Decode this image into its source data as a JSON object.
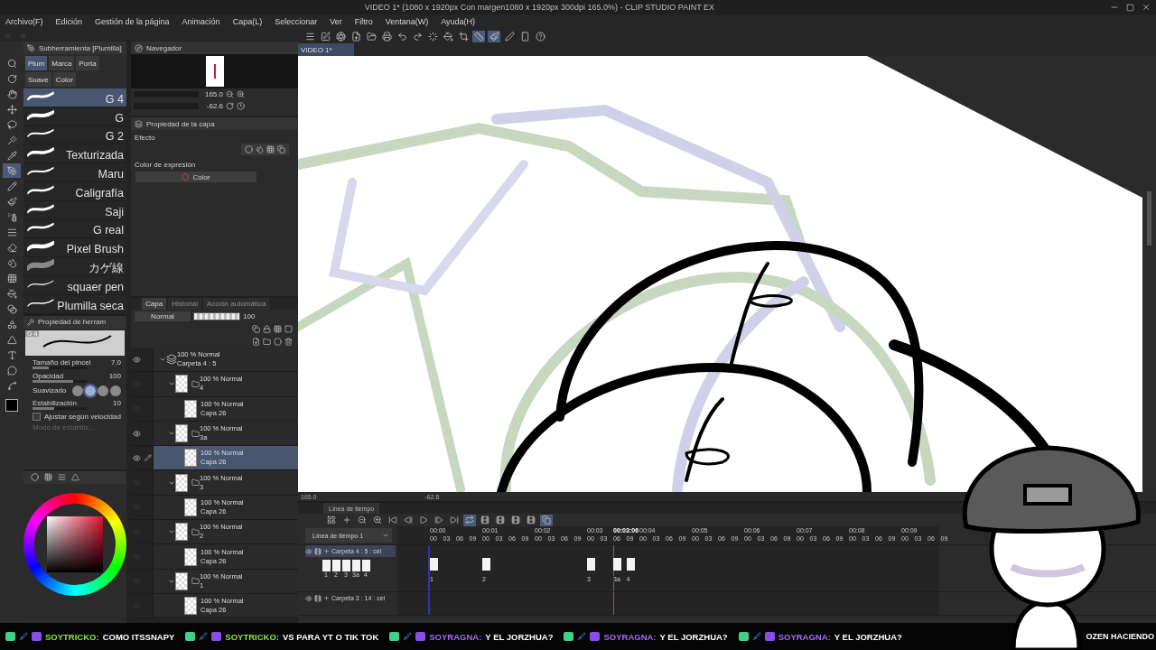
{
  "window": {
    "title": "VIDEO 1* (1080 x 1920px Con margen1080 x 1920px 300dpi 165.0%) - CLIP STUDIO PAINT EX"
  },
  "menu": [
    "Archivo(F)",
    "Edición",
    "Gestión de la página",
    "Animación",
    "Capa(L)",
    "Seleccionar",
    "Ver",
    "Filtro",
    "Ventana(W)",
    "Ayuda(H)"
  ],
  "toolbar": [
    {
      "kind": "menu",
      "selected": false
    },
    {
      "kind": "edit",
      "selected": false
    },
    {
      "kind": "logo",
      "selected": false
    },
    {
      "kind": "new",
      "selected": false
    },
    {
      "kind": "open",
      "selected": false
    },
    {
      "kind": "export",
      "selected": false
    },
    {
      "kind": "undo",
      "selected": false
    },
    {
      "kind": "redo",
      "selected": false
    },
    {
      "kind": "spinner",
      "selected": false
    },
    {
      "kind": "fill",
      "selected": false
    },
    {
      "kind": "crop",
      "selected": false
    },
    {
      "kind": "ruler",
      "selected": true
    },
    {
      "kind": "brush",
      "selected": true
    },
    {
      "kind": "pen",
      "selected": false
    },
    {
      "kind": "phone",
      "selected": false
    },
    {
      "kind": "help",
      "selected": false
    }
  ],
  "tools": [
    {
      "kind": "zoom",
      "selected": false
    },
    {
      "kind": "rotate",
      "selected": false
    },
    {
      "kind": "object",
      "selected": false
    },
    {
      "kind": "move",
      "selected": false
    },
    {
      "kind": "lasso",
      "selected": false
    },
    {
      "kind": "wand",
      "selected": false
    },
    {
      "kind": "eyedropper",
      "selected": false
    },
    {
      "kind": "pen",
      "selected": true
    },
    {
      "kind": "pencil",
      "selected": false
    },
    {
      "kind": "brush",
      "selected": false
    },
    {
      "kind": "airbrush",
      "selected": false
    },
    {
      "kind": "decoration",
      "selected": false
    },
    {
      "kind": "eraser",
      "selected": false
    },
    {
      "kind": "blend",
      "selected": false
    },
    {
      "kind": "frame",
      "selected": false
    },
    {
      "kind": "fill",
      "selected": false
    },
    {
      "kind": "gradient",
      "selected": false
    },
    {
      "kind": "shape",
      "selected": false
    },
    {
      "kind": "figure",
      "selected": false
    },
    {
      "kind": "text",
      "selected": false
    },
    {
      "kind": "balloon",
      "selected": false
    },
    {
      "kind": "correct",
      "selected": false
    }
  ],
  "subtool": {
    "title": "Subherramienta [Plumilla]",
    "groups": [
      {
        "label": "Plum",
        "selected": true
      },
      {
        "label": "Marca",
        "selected": false
      },
      {
        "label": "Porta",
        "selected": false
      },
      {
        "label": "Suave",
        "selected": false
      },
      {
        "label": "Color",
        "selected": false
      }
    ],
    "brushes": [
      {
        "name": "G 4",
        "selected": true
      },
      {
        "name": "G",
        "selected": false
      },
      {
        "name": "G 2",
        "selected": false
      },
      {
        "name": "Texturizada",
        "selected": false
      },
      {
        "name": "Maru",
        "selected": false
      },
      {
        "name": "Caligrafía",
        "selected": false
      },
      {
        "name": "Saji",
        "selected": false
      },
      {
        "name": "G real",
        "selected": false
      },
      {
        "name": "Pixel Brush",
        "selected": false
      },
      {
        "name": "カゲ線",
        "selected": false
      },
      {
        "name": "squaer pen",
        "selected": false
      },
      {
        "name": "Plumilla seca",
        "selected": false
      }
    ]
  },
  "navigator": {
    "tab": "Navegador",
    "zoom": "165.0",
    "angle": "-62.6"
  },
  "layer_property": {
    "tab": "Propiedad de la capa",
    "effect": "Efecto",
    "expression": "Color de expresión",
    "expression_value": "Color"
  },
  "tool_property": {
    "title": "Propiedad de herram",
    "preview_label": "G 4",
    "params": [
      {
        "kind": "slider",
        "label": "Tamaño del pincel",
        "value": "7.0",
        "level": 0.3
      },
      {
        "kind": "slider",
        "label": "Opacidad",
        "value": "100",
        "level": 0.75
      },
      {
        "kind": "options",
        "label": "Suavizado",
        "options": [
          {
            "selected": false
          },
          {
            "selected": true
          },
          {
            "selected": false
          },
          {
            "selected": false
          }
        ]
      },
      {
        "kind": "slider",
        "label": "Estabilización",
        "value": "10",
        "level": 0.4
      },
      {
        "kind": "checkbox",
        "label": "Ajustar según velocidad",
        "checked": false
      },
      {
        "kind": "note",
        "label": "Modo de estabiliz...",
        "disabled": true
      }
    ]
  },
  "layers": {
    "tabs": [
      {
        "label": "Capa",
        "selected": true
      },
      {
        "label": "Historial",
        "selected": false
      },
      {
        "label": "Acción automática",
        "selected": false
      }
    ],
    "blend": "Normal",
    "opacity": "100",
    "opacity_bar": {
      "level": 1
    },
    "items": [
      {
        "kind": "animation_folder",
        "mode": "100 % Normal",
        "name": "Carpeta 4 : 5",
        "visible": true,
        "expanded": true,
        "selected": false,
        "children": [
          {
            "kind": "folder",
            "mode": "100 % Normal",
            "name": "4",
            "visible": false,
            "expanded": true,
            "selected": false,
            "children": [
              {
                "kind": "layer",
                "mode": "100 % Normal",
                "name": "Capa 26",
                "visible": false,
                "selected": false
              }
            ]
          },
          {
            "kind": "folder",
            "mode": "100 % Normal",
            "name": "3a",
            "visible": true,
            "expanded": true,
            "selected": false,
            "children": [
              {
                "kind": "layer",
                "mode": "100 % Normal",
                "name": "Capa 26",
                "visible": true,
                "selected": true
              }
            ]
          },
          {
            "kind": "folder",
            "mode": "100 % Normal",
            "name": "3",
            "visible": false,
            "expanded": true,
            "selected": false,
            "children": [
              {
                "kind": "layer",
                "mode": "100 % Normal",
                "name": "Capa 26",
                "visible": false,
                "selected": false
              }
            ]
          },
          {
            "kind": "folder",
            "mode": "100 % Normal",
            "name": "2",
            "visible": false,
            "expanded": true,
            "selected": false,
            "children": [
              {
                "kind": "layer",
                "mode": "100 % Normal",
                "name": "Capa 26",
                "visible": false,
                "selected": false
              }
            ]
          },
          {
            "kind": "folder",
            "mode": "100 % Normal",
            "name": "1",
            "visible": false,
            "expanded": true,
            "selected": false,
            "children": [
              {
                "kind": "layer",
                "mode": "100 % Normal",
                "name": "Capa 26",
                "visible": false,
                "selected": false
              }
            ]
          }
        ]
      }
    ]
  },
  "canvas": {
    "tab": "VIDEO 1*",
    "zoom": "165.0",
    "angle": "-62.6"
  },
  "timeline": {
    "tab": "Línea de tiempo",
    "selector": "Línea de tiempo 1",
    "current": "00:03:06",
    "toolbar": [
      {
        "kind": "grid",
        "selected": false
      },
      {
        "kind": "add",
        "selected": false
      },
      {
        "kind": "zoom_out",
        "selected": false
      },
      {
        "kind": "zoom_in",
        "selected": false
      },
      {
        "kind": "first",
        "selected": false
      },
      {
        "kind": "prev",
        "selected": false
      },
      {
        "kind": "play",
        "selected": false
      },
      {
        "kind": "next",
        "selected": false
      },
      {
        "kind": "last",
        "selected": false
      },
      {
        "kind": "loop",
        "selected": true
      },
      {
        "kind": "cel",
        "selected": false
      },
      {
        "kind": "cel",
        "selected": false
      },
      {
        "kind": "cel",
        "selected": false
      },
      {
        "kind": "cel",
        "selected": false
      },
      {
        "kind": "onion",
        "selected": true
      }
    ],
    "seconds": [
      {
        "label": "00:00",
        "frames": [
          "00",
          "03",
          "06",
          "09"
        ]
      },
      {
        "label": "00:01",
        "frames": [
          "00",
          "03",
          "06",
          "09"
        ]
      },
      {
        "label": "00:02",
        "frames": [
          "00",
          "03",
          "06",
          "09"
        ]
      },
      {
        "label": "00:03",
        "frames": [
          "00",
          "03",
          "06",
          "09"
        ]
      },
      {
        "label": "00:04",
        "frames": [
          "00",
          "03",
          "06",
          "09"
        ]
      },
      {
        "label": "00:05",
        "frames": [
          "00",
          "03",
          "06",
          "09"
        ]
      },
      {
        "label": "00:06",
        "frames": [
          "00",
          "03",
          "06",
          "09"
        ]
      },
      {
        "label": "00:07",
        "frames": [
          "00",
          "03",
          "06",
          "09"
        ]
      },
      {
        "label": "00:08",
        "frames": [
          "00",
          "03",
          "06",
          "09"
        ]
      },
      {
        "label": "00:09",
        "frames": [
          "00",
          "03",
          "06",
          "09"
        ]
      }
    ],
    "tracks": [
      {
        "name": "Carpeta 4 : 5 : cel",
        "selected": true,
        "thumbs": [
          "1",
          "2",
          "3",
          "3a",
          "4"
        ],
        "cels": [
          "1",
          "2",
          "3",
          "3a",
          "4"
        ]
      },
      {
        "name": "Carpeta 3 : 14 : cel",
        "selected": false
      }
    ]
  },
  "ticker": {
    "messages": [
      {
        "user": "SOYTRICKO:",
        "text": "COMO ITSSNAPY",
        "color": "#8fe24a"
      },
      {
        "user": "SOYTRICKO:",
        "text": "VS PARA YT O TIK TOK",
        "color": "#8fe24a"
      },
      {
        "user": "SOYRAGNA:",
        "text": "Y EL JORZHUA?",
        "color": "#a66cf0"
      },
      {
        "user": "SOYRAGNA:",
        "text": "Y EL JORZHUA?",
        "color": "#a66cf0"
      },
      {
        "user": "SOYRAGNA:",
        "text": "Y EL JORZHUA?",
        "color": "#a66cf0"
      }
    ],
    "tail": "OZEN HACIENDO"
  }
}
